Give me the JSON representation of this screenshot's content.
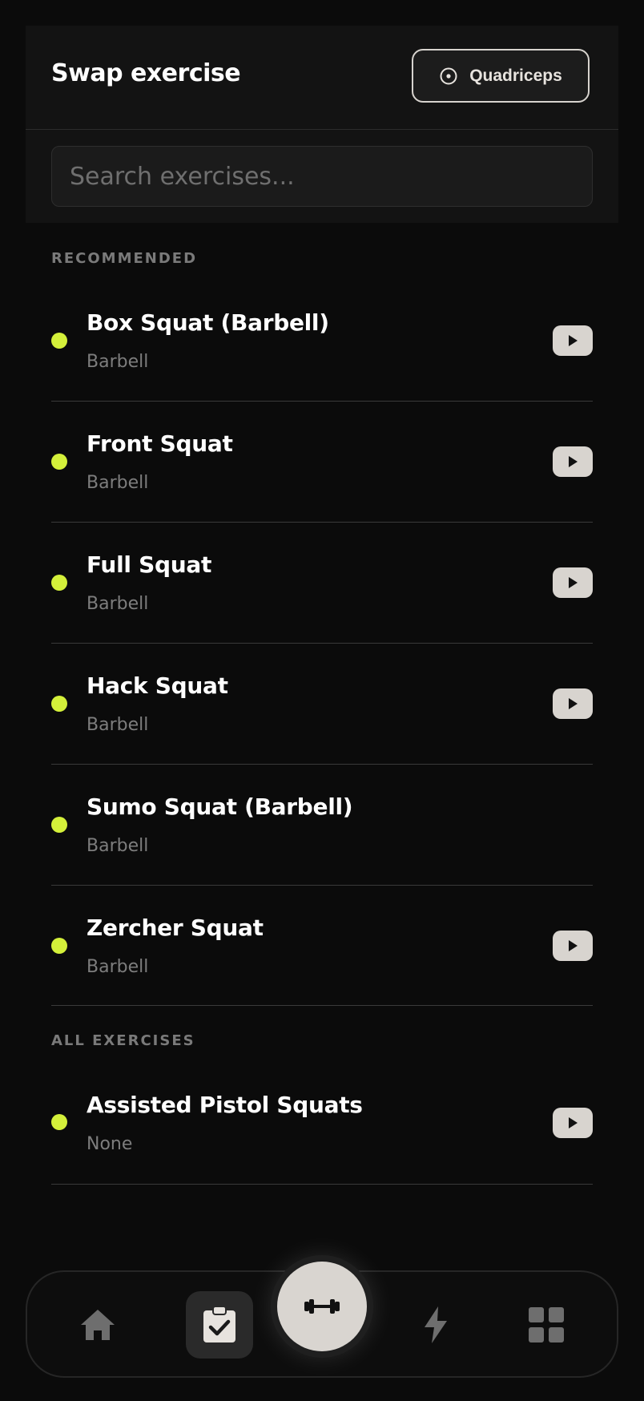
{
  "header": {
    "title": "Swap exercise",
    "muscle_filter": {
      "label": "Quadriceps",
      "icon": "target-icon"
    }
  },
  "search": {
    "placeholder": "Search exercises...",
    "value": ""
  },
  "sections": {
    "recommended": "RECOMMENDED",
    "all": "ALL EXERCISES"
  },
  "recommended": [
    {
      "name": "Box Squat (Barbell)",
      "equipment": "Barbell",
      "has_video": true
    },
    {
      "name": "Front Squat",
      "equipment": "Barbell",
      "has_video": true
    },
    {
      "name": "Full Squat",
      "equipment": "Barbell",
      "has_video": true
    },
    {
      "name": "Hack Squat",
      "equipment": "Barbell",
      "has_video": true
    },
    {
      "name": "Sumo Squat (Barbell)",
      "equipment": "Barbell",
      "has_video": false
    },
    {
      "name": "Zercher Squat",
      "equipment": "Barbell",
      "has_video": true
    }
  ],
  "all_exercises": [
    {
      "name": "Assisted Pistol Squats",
      "equipment": "None",
      "has_video": true
    }
  ],
  "nav": {
    "items": [
      "home-icon",
      "clipboard-check-icon",
      "dumbbell-icon",
      "lightning-icon",
      "grid-icon"
    ],
    "active": "clipboard-check-icon"
  },
  "colors": {
    "accent_dot": "#d4f03a",
    "background": "#0b0b0b",
    "chip": "#d8d4cf"
  }
}
